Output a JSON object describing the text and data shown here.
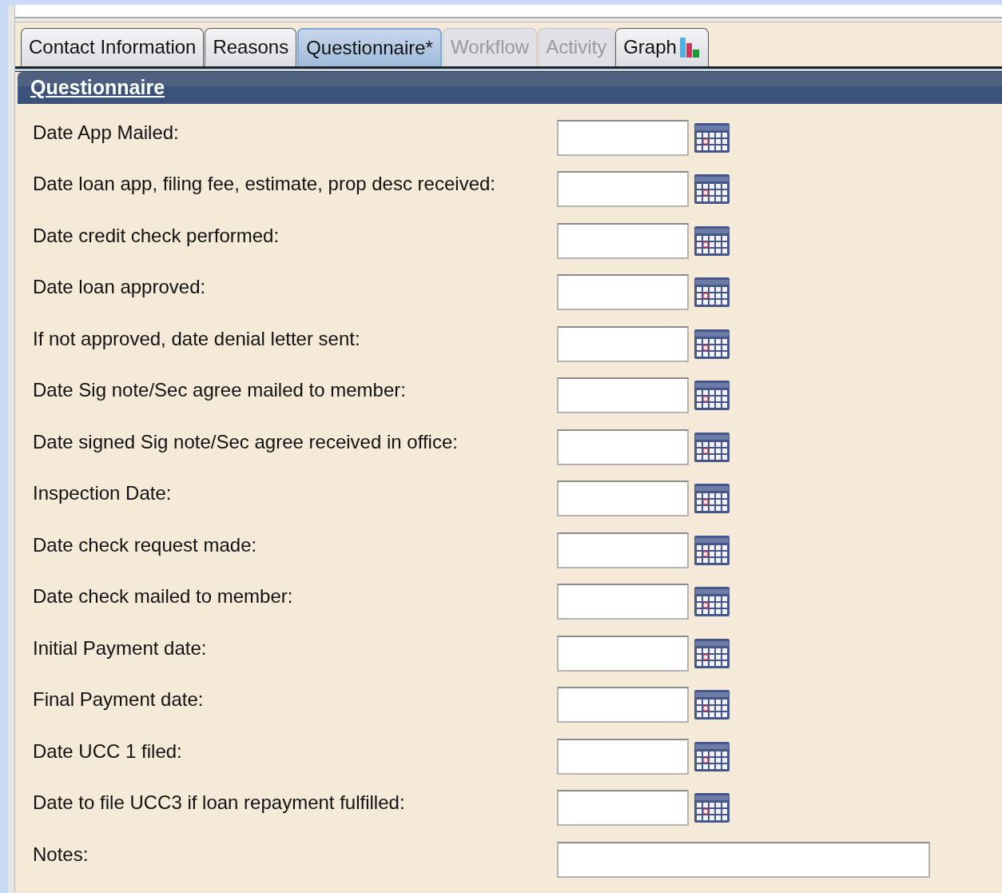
{
  "tabs": [
    {
      "label": "Contact Information",
      "selected": false,
      "disabled": false
    },
    {
      "label": "Reasons",
      "selected": false,
      "disabled": false
    },
    {
      "label": "Questionnaire*",
      "selected": true,
      "disabled": false
    },
    {
      "label": "Workflow",
      "selected": false,
      "disabled": true
    },
    {
      "label": "Activity",
      "selected": false,
      "disabled": true
    },
    {
      "label": "Graph",
      "selected": false,
      "disabled": false,
      "kind": "graph"
    }
  ],
  "section": {
    "title": "Questionnaire"
  },
  "fields": [
    {
      "label": "Date App Mailed:",
      "kind": "date"
    },
    {
      "label": "Date loan app, filing fee, estimate, prop desc received:",
      "kind": "date"
    },
    {
      "label": "Date credit check performed:",
      "kind": "date"
    },
    {
      "label": "Date loan approved:",
      "kind": "date"
    },
    {
      "label": "If not approved, date denial letter sent:",
      "kind": "date"
    },
    {
      "label": "Date Sig note/Sec agree mailed to member:",
      "kind": "date"
    },
    {
      "label": "Date signed Sig note/Sec agree received in office:",
      "kind": "date"
    },
    {
      "label": "Inspection Date:",
      "kind": "date"
    },
    {
      "label": "Date check request made:",
      "kind": "date"
    },
    {
      "label": "Date check mailed to member:",
      "kind": "date"
    },
    {
      "label": "Initial Payment date:",
      "kind": "date"
    },
    {
      "label": "Final Payment date:",
      "kind": "date"
    },
    {
      "label": "Date UCC 1 filed:",
      "kind": "date"
    },
    {
      "label": "Date to file UCC3 if loan repayment fulfilled:",
      "kind": "date"
    },
    {
      "label": "Notes:",
      "kind": "text"
    }
  ]
}
